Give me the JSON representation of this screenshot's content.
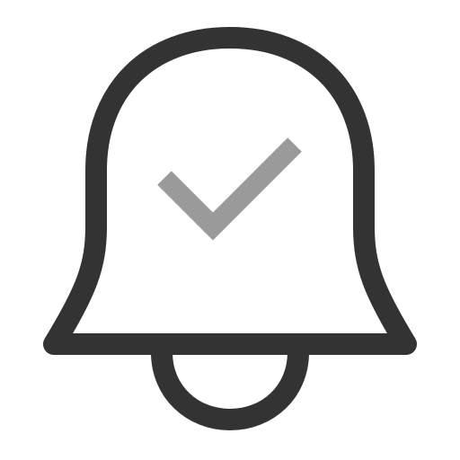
{
  "icon": {
    "name": "bell-check-icon",
    "parts": [
      "bell-outline",
      "bell-clapper",
      "check-mark"
    ]
  },
  "colors": {
    "background": "#ffffff",
    "outline": "#333333",
    "check": "#9a9a9a"
  }
}
